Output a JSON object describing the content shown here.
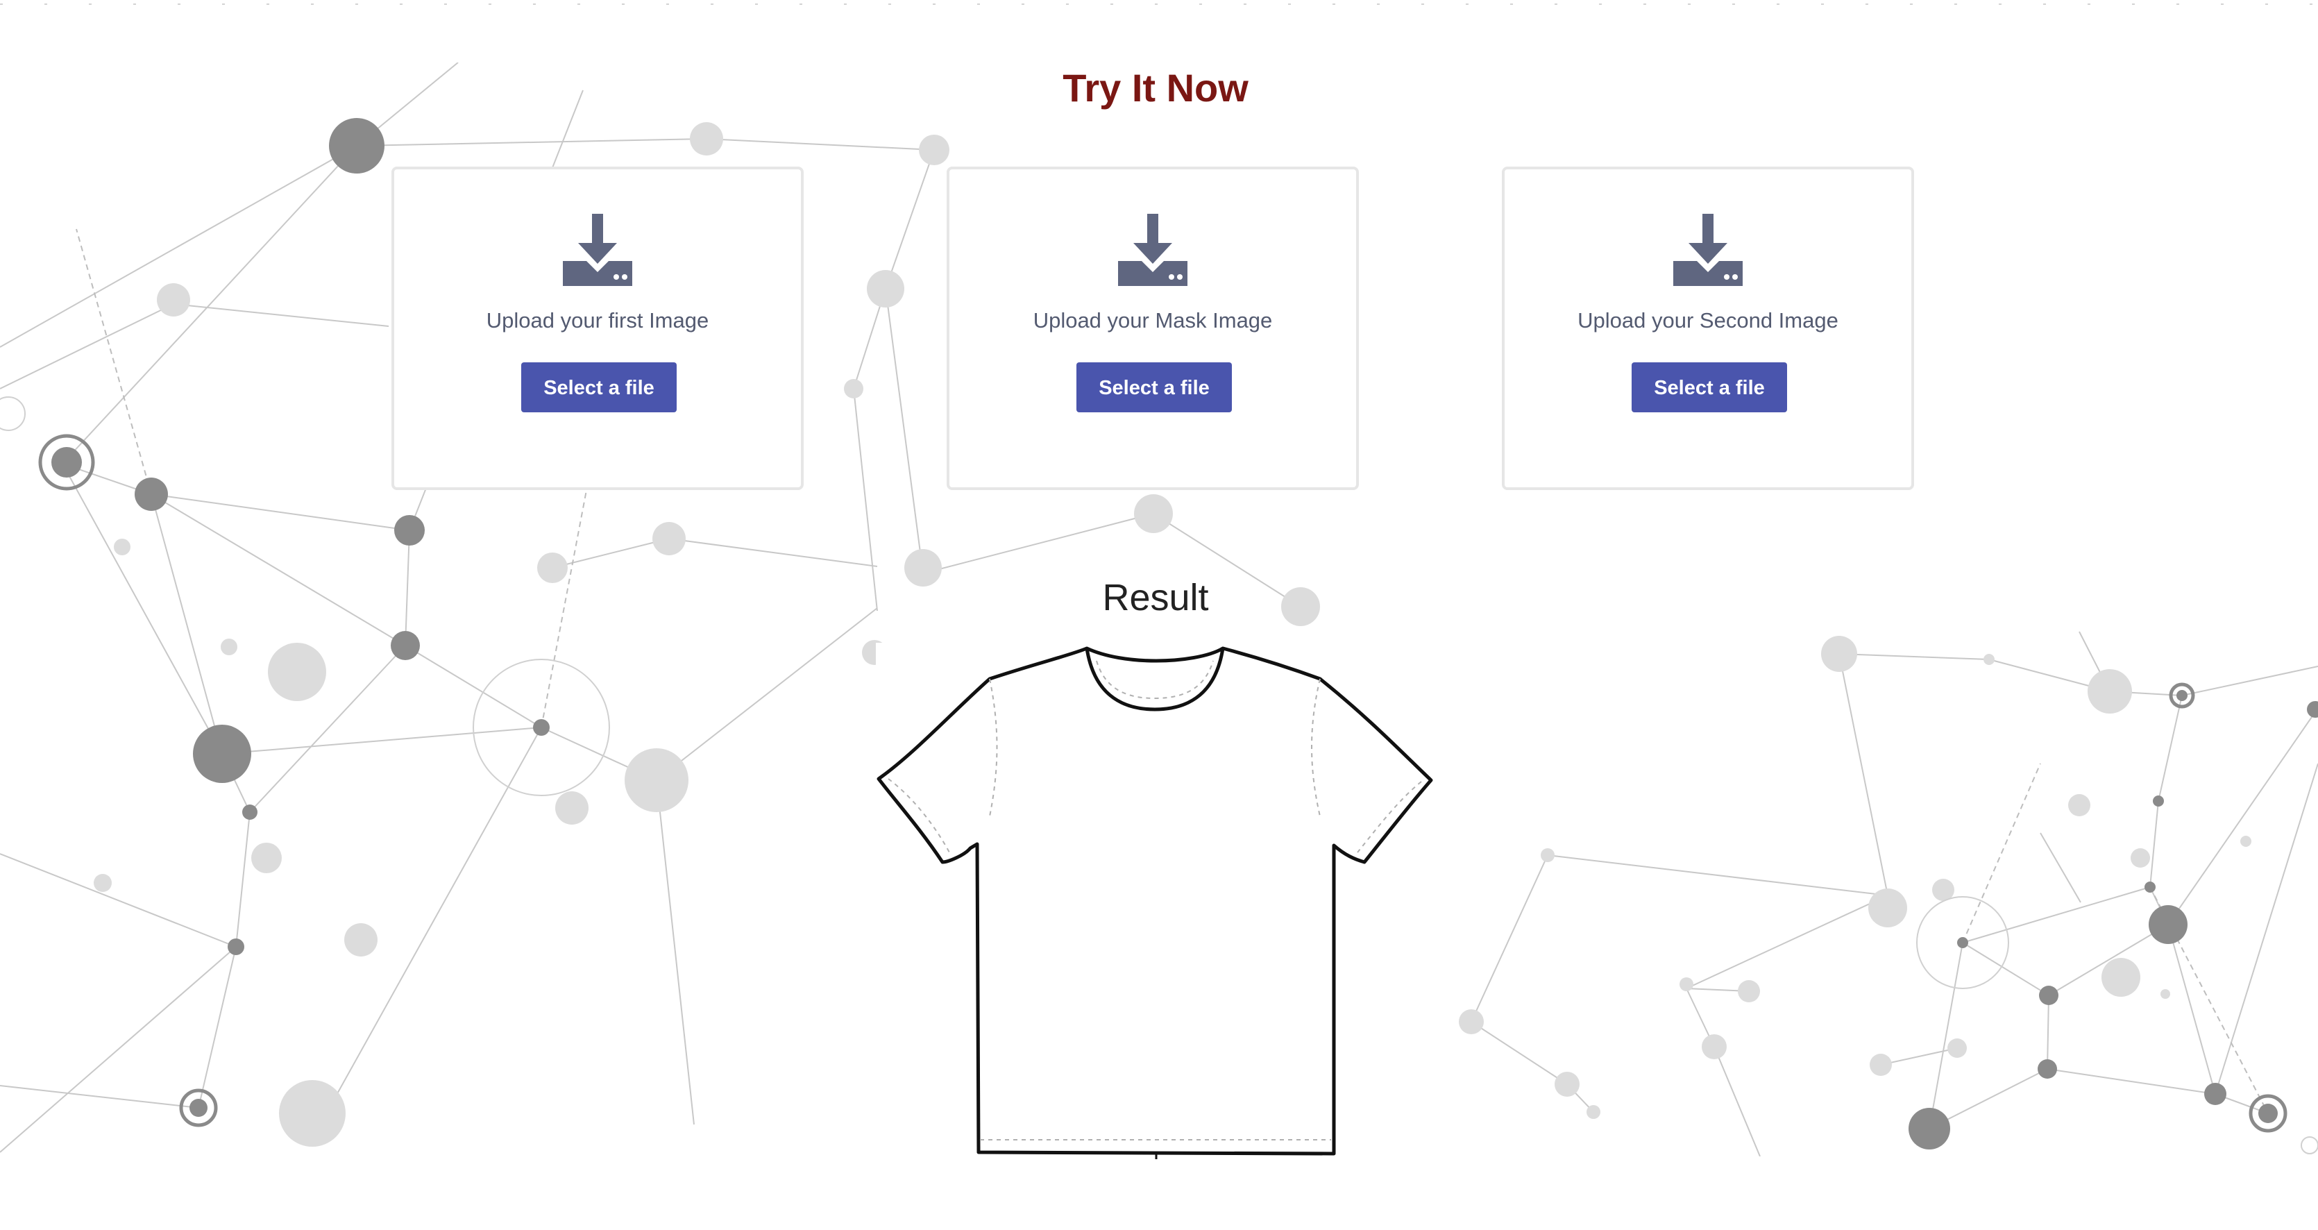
{
  "section": {
    "title": "Try It Now"
  },
  "uploads": [
    {
      "label": "Upload your first Image",
      "button": "Select a file",
      "icon": "download-tray-icon"
    },
    {
      "label": "Upload your Mask Image",
      "button": "Select a file",
      "icon": "download-tray-icon"
    },
    {
      "label": "Upload your Second Image",
      "button": "Select a file",
      "icon": "download-tray-icon"
    }
  ],
  "result": {
    "heading": "Result",
    "image": "tshirt-outline"
  },
  "colors": {
    "title": "#7a1713",
    "button": "#4a55ad",
    "icon": "#5f6680",
    "card_border": "#e6e6e6"
  }
}
